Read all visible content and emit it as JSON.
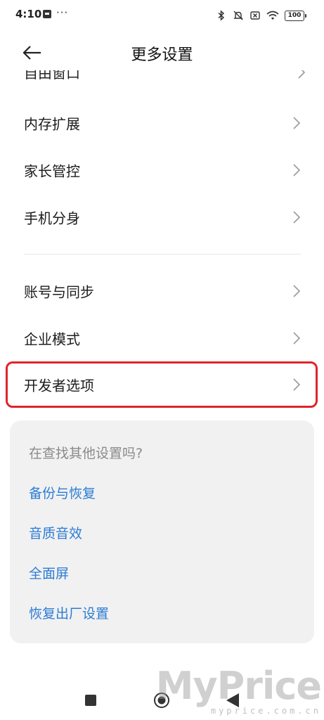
{
  "status_bar": {
    "time": "4:10",
    "dots": "···",
    "battery": "100"
  },
  "header": {
    "title": "更多设置"
  },
  "list": {
    "partial_item": "自由窗口",
    "items": [
      {
        "label": "内存扩展"
      },
      {
        "label": "家长管控"
      },
      {
        "label": "手机分身"
      },
      {
        "label": "账号与同步"
      },
      {
        "label": "企业模式"
      },
      {
        "label": "开发者选项"
      }
    ]
  },
  "suggestions": {
    "title": "在查找其他设置吗?",
    "links": [
      {
        "label": "备份与恢复"
      },
      {
        "label": "音质音效"
      },
      {
        "label": "全面屏"
      },
      {
        "label": "恢复出厂设置"
      }
    ]
  },
  "watermark": {
    "logo": "MyPrice",
    "url": "myprice.com.cn"
  },
  "colors": {
    "highlight": "#e0242a",
    "link": "#2b7cd3",
    "card_bg": "#f1f1f2"
  }
}
